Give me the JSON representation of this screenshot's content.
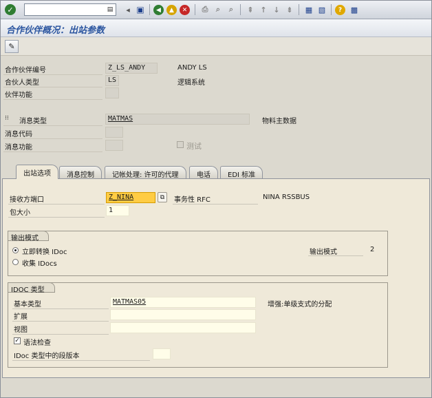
{
  "window": {
    "title": "合作伙伴概况：出站参数"
  },
  "toolbar": {
    "command_placeholder": ""
  },
  "header_fields": {
    "partner_number_label": "合作伙伴编号",
    "partner_number_value": "Z_LS_ANDY",
    "partner_number_desc": "ANDY LS",
    "partner_type_label": "合伙人类型",
    "partner_type_value": "LS",
    "partner_type_desc": "逻辑系统",
    "partner_role_label": "伙伴功能",
    "partner_role_value": ""
  },
  "message_fields": {
    "message_type_label": "消息类型",
    "message_type_value": "MATMAS",
    "message_type_desc": "物料主数据",
    "message_code_label": "消息代码",
    "message_code_value": "",
    "message_function_label": "消息功能",
    "message_function_value": "",
    "test_label": "测试",
    "test_checked": false
  },
  "tabs": [
    {
      "label": "出站选项",
      "active": true
    },
    {
      "label": "消息控制",
      "active": false
    },
    {
      "label": "记帐处理: 许可的代理",
      "active": false
    },
    {
      "label": "电话",
      "active": false
    },
    {
      "label": "EDI 标准",
      "active": false
    }
  ],
  "outbound": {
    "receiver_port_label": "接收方端口",
    "receiver_port_value": "Z_NINA",
    "port_type": "事务性 RFC",
    "port_desc": "NINA RSSBUS",
    "packet_size_label": "包大小",
    "packet_size_value": "1"
  },
  "output_mode": {
    "title": "输出模式",
    "option_immediate": "立即转换 IDoc",
    "option_collect": "收集 IDocs",
    "selected": "immediate",
    "mode_label": "输出模式",
    "mode_value": "2"
  },
  "idoc_type": {
    "title": "IDOC 类型",
    "basic_type_label": "基本类型",
    "basic_type_value": "MATMAS05",
    "basic_type_desc": "增强:单级支式的分配",
    "extension_label": "扩展",
    "extension_value": "",
    "view_label": "视图",
    "view_value": "",
    "syntax_check_label": "语法检查",
    "syntax_check_checked": true,
    "segment_release_label": "IDoc 类型中的段版本",
    "segment_release_value": ""
  }
}
